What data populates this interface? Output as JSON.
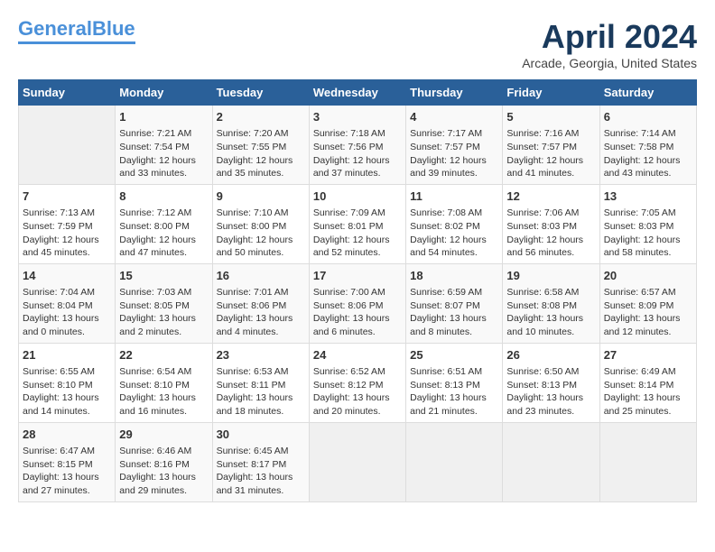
{
  "header": {
    "logo_line1": "General",
    "logo_line2": "Blue",
    "title": "April 2024",
    "subtitle": "Arcade, Georgia, United States"
  },
  "weekdays": [
    "Sunday",
    "Monday",
    "Tuesday",
    "Wednesday",
    "Thursday",
    "Friday",
    "Saturday"
  ],
  "weeks": [
    [
      {
        "day": "",
        "info": ""
      },
      {
        "day": "1",
        "info": "Sunrise: 7:21 AM\nSunset: 7:54 PM\nDaylight: 12 hours\nand 33 minutes."
      },
      {
        "day": "2",
        "info": "Sunrise: 7:20 AM\nSunset: 7:55 PM\nDaylight: 12 hours\nand 35 minutes."
      },
      {
        "day": "3",
        "info": "Sunrise: 7:18 AM\nSunset: 7:56 PM\nDaylight: 12 hours\nand 37 minutes."
      },
      {
        "day": "4",
        "info": "Sunrise: 7:17 AM\nSunset: 7:57 PM\nDaylight: 12 hours\nand 39 minutes."
      },
      {
        "day": "5",
        "info": "Sunrise: 7:16 AM\nSunset: 7:57 PM\nDaylight: 12 hours\nand 41 minutes."
      },
      {
        "day": "6",
        "info": "Sunrise: 7:14 AM\nSunset: 7:58 PM\nDaylight: 12 hours\nand 43 minutes."
      }
    ],
    [
      {
        "day": "7",
        "info": "Sunrise: 7:13 AM\nSunset: 7:59 PM\nDaylight: 12 hours\nand 45 minutes."
      },
      {
        "day": "8",
        "info": "Sunrise: 7:12 AM\nSunset: 8:00 PM\nDaylight: 12 hours\nand 47 minutes."
      },
      {
        "day": "9",
        "info": "Sunrise: 7:10 AM\nSunset: 8:00 PM\nDaylight: 12 hours\nand 50 minutes."
      },
      {
        "day": "10",
        "info": "Sunrise: 7:09 AM\nSunset: 8:01 PM\nDaylight: 12 hours\nand 52 minutes."
      },
      {
        "day": "11",
        "info": "Sunrise: 7:08 AM\nSunset: 8:02 PM\nDaylight: 12 hours\nand 54 minutes."
      },
      {
        "day": "12",
        "info": "Sunrise: 7:06 AM\nSunset: 8:03 PM\nDaylight: 12 hours\nand 56 minutes."
      },
      {
        "day": "13",
        "info": "Sunrise: 7:05 AM\nSunset: 8:03 PM\nDaylight: 12 hours\nand 58 minutes."
      }
    ],
    [
      {
        "day": "14",
        "info": "Sunrise: 7:04 AM\nSunset: 8:04 PM\nDaylight: 13 hours\nand 0 minutes."
      },
      {
        "day": "15",
        "info": "Sunrise: 7:03 AM\nSunset: 8:05 PM\nDaylight: 13 hours\nand 2 minutes."
      },
      {
        "day": "16",
        "info": "Sunrise: 7:01 AM\nSunset: 8:06 PM\nDaylight: 13 hours\nand 4 minutes."
      },
      {
        "day": "17",
        "info": "Sunrise: 7:00 AM\nSunset: 8:06 PM\nDaylight: 13 hours\nand 6 minutes."
      },
      {
        "day": "18",
        "info": "Sunrise: 6:59 AM\nSunset: 8:07 PM\nDaylight: 13 hours\nand 8 minutes."
      },
      {
        "day": "19",
        "info": "Sunrise: 6:58 AM\nSunset: 8:08 PM\nDaylight: 13 hours\nand 10 minutes."
      },
      {
        "day": "20",
        "info": "Sunrise: 6:57 AM\nSunset: 8:09 PM\nDaylight: 13 hours\nand 12 minutes."
      }
    ],
    [
      {
        "day": "21",
        "info": "Sunrise: 6:55 AM\nSunset: 8:10 PM\nDaylight: 13 hours\nand 14 minutes."
      },
      {
        "day": "22",
        "info": "Sunrise: 6:54 AM\nSunset: 8:10 PM\nDaylight: 13 hours\nand 16 minutes."
      },
      {
        "day": "23",
        "info": "Sunrise: 6:53 AM\nSunset: 8:11 PM\nDaylight: 13 hours\nand 18 minutes."
      },
      {
        "day": "24",
        "info": "Sunrise: 6:52 AM\nSunset: 8:12 PM\nDaylight: 13 hours\nand 20 minutes."
      },
      {
        "day": "25",
        "info": "Sunrise: 6:51 AM\nSunset: 8:13 PM\nDaylight: 13 hours\nand 21 minutes."
      },
      {
        "day": "26",
        "info": "Sunrise: 6:50 AM\nSunset: 8:13 PM\nDaylight: 13 hours\nand 23 minutes."
      },
      {
        "day": "27",
        "info": "Sunrise: 6:49 AM\nSunset: 8:14 PM\nDaylight: 13 hours\nand 25 minutes."
      }
    ],
    [
      {
        "day": "28",
        "info": "Sunrise: 6:47 AM\nSunset: 8:15 PM\nDaylight: 13 hours\nand 27 minutes."
      },
      {
        "day": "29",
        "info": "Sunrise: 6:46 AM\nSunset: 8:16 PM\nDaylight: 13 hours\nand 29 minutes."
      },
      {
        "day": "30",
        "info": "Sunrise: 6:45 AM\nSunset: 8:17 PM\nDaylight: 13 hours\nand 31 minutes."
      },
      {
        "day": "",
        "info": ""
      },
      {
        "day": "",
        "info": ""
      },
      {
        "day": "",
        "info": ""
      },
      {
        "day": "",
        "info": ""
      }
    ]
  ]
}
